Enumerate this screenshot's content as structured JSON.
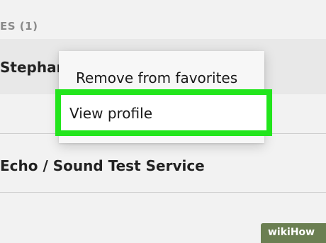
{
  "section_header": "ES (1)",
  "contacts": [
    {
      "name": "Stephani"
    },
    {
      "name": "Echo / Sound Test Service"
    }
  ],
  "context_menu": {
    "items": [
      {
        "label": "Remove from favorites"
      },
      {
        "label": "View profile"
      }
    ],
    "highlight_color": "#22e51c"
  },
  "watermark": "wikiHow"
}
